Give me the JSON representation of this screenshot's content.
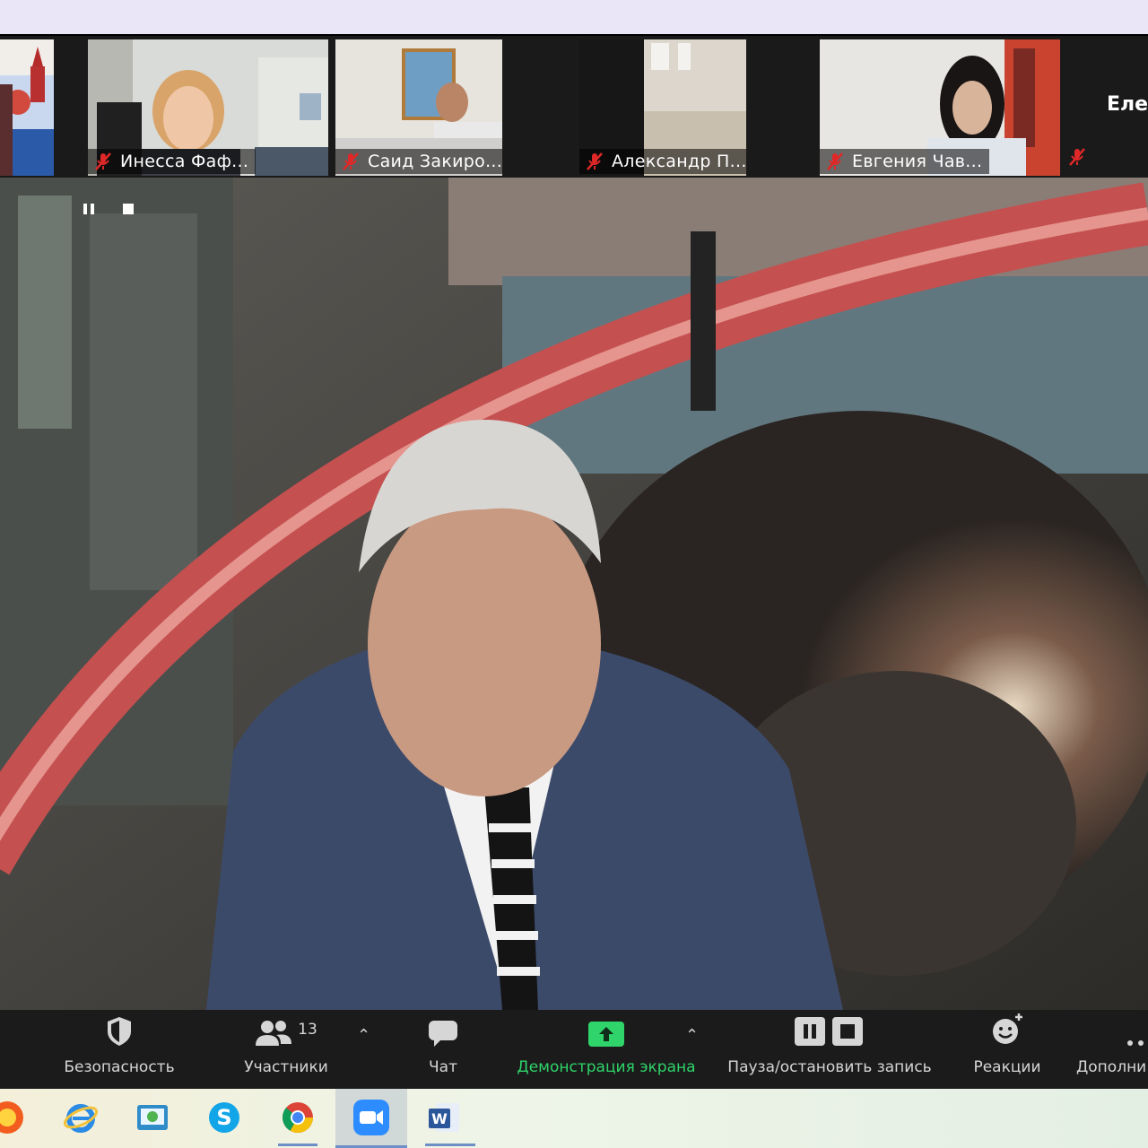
{
  "gallery": {
    "participants": [
      {
        "name": "",
        "muted": false
      },
      {
        "name": "Инесса Фаф...",
        "muted": true
      },
      {
        "name": "Саид Закиро...",
        "muted": true
      },
      {
        "name": "Александр П...",
        "muted": true
      },
      {
        "name": "Евгения Чав...",
        "muted": true
      }
    ],
    "overflow_name": "Елен"
  },
  "recording": {
    "pause_icon": "pause-icon",
    "stop_icon": "stop-icon"
  },
  "toolbar": {
    "security_label": "Безопасность",
    "participants_label": "Участники",
    "participants_count": "13",
    "chat_label": "Чат",
    "share_label": "Демонстрация экрана",
    "record_label": "Пауза/остановить запись",
    "reactions_label": "Реакции",
    "more_label": "Дополни"
  },
  "taskbar": {
    "icons": [
      "yandex-icon",
      "internet-explorer-icon",
      "photo-viewer-icon",
      "skype-icon",
      "chrome-icon",
      "zoom-icon",
      "word-icon"
    ]
  },
  "colors": {
    "accent_green": "#2fd46a",
    "mute_red": "#e02828",
    "toolbar_bg": "#1b1b1b"
  }
}
